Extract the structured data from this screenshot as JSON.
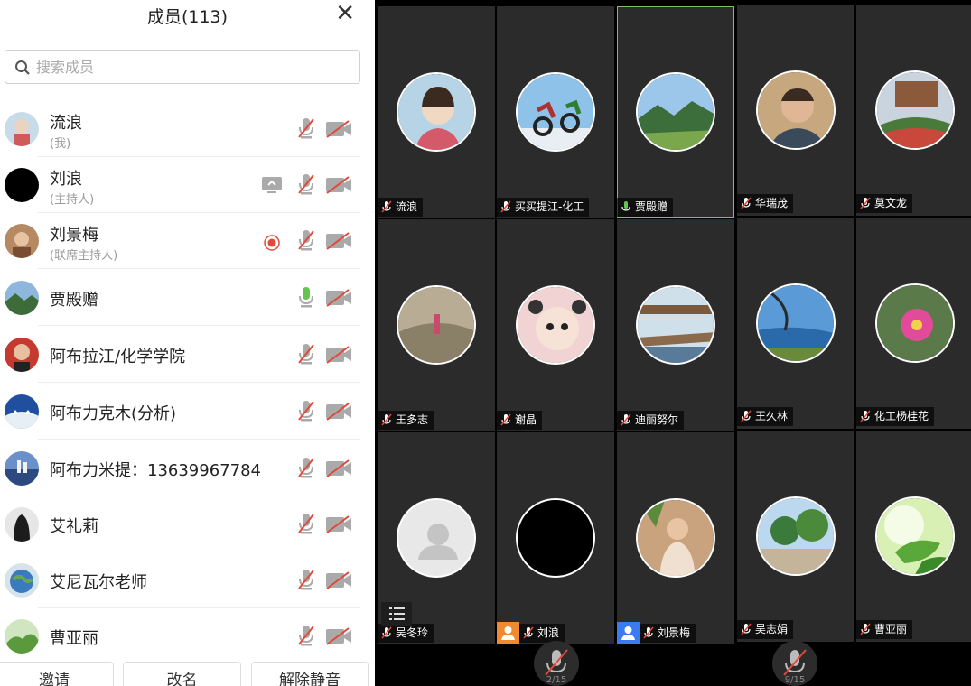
{
  "header": {
    "title": "成员(113)",
    "close": "✕"
  },
  "search": {
    "placeholder": "搜索成员"
  },
  "members": [
    {
      "name": "流浪",
      "role": "(我)",
      "mic": "muted",
      "video": "off",
      "extra": ""
    },
    {
      "name": "刘浪",
      "role": "(主持人)",
      "mic": "muted",
      "video": "off",
      "extra": "screen-share"
    },
    {
      "name": "刘景梅",
      "role": "(联席主持人)",
      "mic": "muted",
      "video": "off",
      "extra": "recording"
    },
    {
      "name": "贾殿赠",
      "role": "",
      "mic": "active",
      "video": "off",
      "extra": ""
    },
    {
      "name": "阿布拉江/化学学院",
      "role": "",
      "mic": "muted",
      "video": "off",
      "extra": ""
    },
    {
      "name": "阿布力克木(分析)",
      "role": "",
      "mic": "muted",
      "video": "off",
      "extra": ""
    },
    {
      "name": "阿布力米提：13639967784",
      "role": "",
      "mic": "muted",
      "video": "off",
      "extra": ""
    },
    {
      "name": "艾礼莉",
      "role": "",
      "mic": "muted",
      "video": "off",
      "extra": ""
    },
    {
      "name": "艾尼瓦尔老师",
      "role": "",
      "mic": "muted",
      "video": "off",
      "extra": ""
    },
    {
      "name": "曹亚丽",
      "role": "",
      "mic": "muted",
      "video": "off",
      "extra": ""
    }
  ],
  "buttons": {
    "invite": "邀请",
    "rename": "改名",
    "unmute": "解除静音"
  },
  "grid": [
    {
      "name": "流浪",
      "mic": "muted"
    },
    {
      "name": "买买提江-化工",
      "mic": "muted"
    },
    {
      "name": "贾殿赠",
      "mic": "active",
      "selected": true
    },
    {
      "name": "华瑞茂",
      "mic": "muted"
    },
    {
      "name": "莫文龙",
      "mic": "muted"
    },
    {
      "name": "王多志",
      "mic": "muted"
    },
    {
      "name": "谢晶",
      "mic": "muted"
    },
    {
      "name": "迪丽努尔",
      "mic": "muted"
    },
    {
      "name": "王久林",
      "mic": "muted"
    },
    {
      "name": "化工杨桂花",
      "mic": "muted"
    },
    {
      "name": "吴冬玲",
      "mic": "muted"
    },
    {
      "name": "刘浪",
      "mic": "muted",
      "badge": "host"
    },
    {
      "name": "刘景梅",
      "mic": "muted",
      "badge": "cohost"
    },
    {
      "name": "吴志娟",
      "mic": "muted"
    },
    {
      "name": "曹亚丽",
      "mic": "muted"
    }
  ],
  "pager": {
    "left": "2/15",
    "right": "9/15"
  },
  "colors": {
    "muted_red": "#e04a3c",
    "active_green": "#63c44f",
    "host_badge": "#f08a30",
    "cohost_badge": "#3a7bf0"
  }
}
